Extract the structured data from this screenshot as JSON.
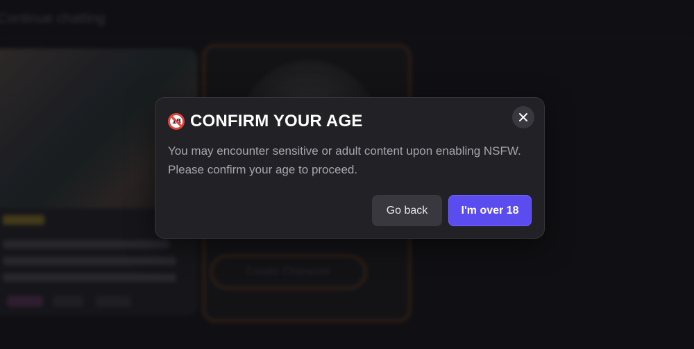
{
  "background": {
    "header_text": "Continue chatting",
    "card2_button_label": "Create Character"
  },
  "modal": {
    "icon": "no-one-under-18-icon",
    "title": "CONFIRM YOUR AGE",
    "body": "You may encounter sensitive or adult content upon enabling NSFW. Please confirm your age to proceed.",
    "close_icon": "close-icon",
    "go_back_label": "Go back",
    "confirm_label": "I'm over 18"
  },
  "colors": {
    "accent": "#5b4cf0",
    "modal_bg": "#222226",
    "page_bg": "#151519",
    "warning": "#e8413b"
  }
}
